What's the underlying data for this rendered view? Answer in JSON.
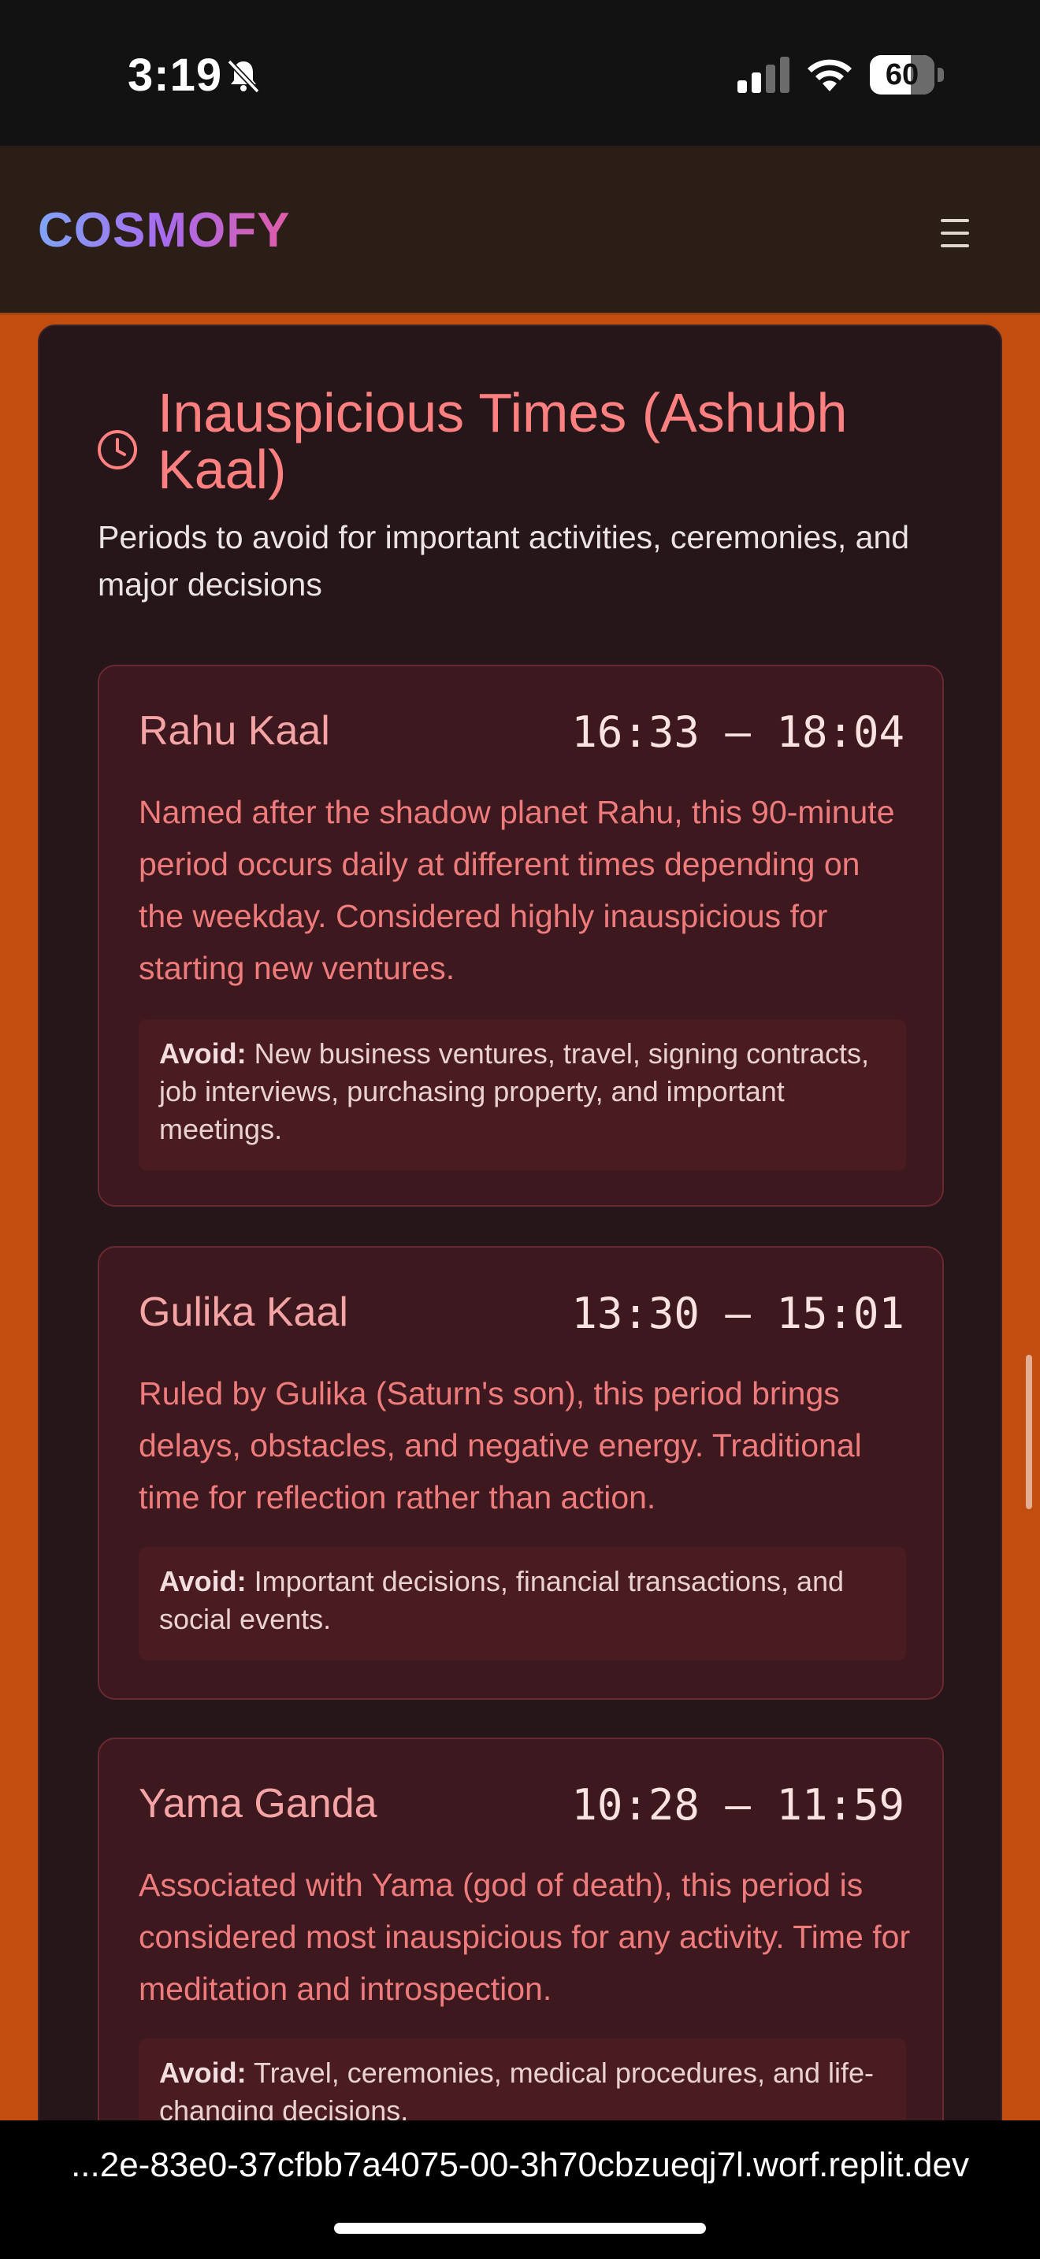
{
  "status_bar": {
    "time": "3:19",
    "battery": "60"
  },
  "nav": {
    "logo": "COSMOFY",
    "menu_icon": "hamburger-menu-icon"
  },
  "section": {
    "title": "Inauspicious Times (Ashubh Kaal)",
    "subtitle": "Periods to avoid for important activities, ceremonies, and major decisions",
    "icon": "clock-icon"
  },
  "periods": [
    {
      "name": "Rahu Kaal",
      "time": "16:33 – 18:04",
      "description": "Named after the shadow planet Rahu, this 90-minute period occurs daily at different times depending on the weekday. Considered highly inauspicious for starting new ventures.",
      "avoid_label": "Avoid:",
      "avoid_text": "New business ventures, travel, signing contracts, job interviews, purchasing property, and important meetings."
    },
    {
      "name": "Gulika Kaal",
      "time": "13:30 – 15:01",
      "description": "Ruled by Gulika (Saturn's son), this period brings delays, obstacles, and negative energy. Traditional time for reflection rather than action.",
      "avoid_label": "Avoid:",
      "avoid_text": "Important decisions, financial transactions, and social events."
    },
    {
      "name": "Yama Ganda",
      "time": "10:28 – 11:59",
      "description": "Associated with Yama (god of death), this period is considered most inauspicious for any activity. Time for meditation and introspection.",
      "avoid_label": "Avoid:",
      "avoid_text": "Travel, ceremonies, medical procedures, and life-changing decisions."
    }
  ],
  "browser": {
    "url": "...2e-83e0-37cfbb7a4075-00-3h70cbzueqj7l.worf.replit.dev"
  },
  "colors": {
    "page_background": "#c24d0e",
    "card_background": "#26161a",
    "accent": "#ff8080"
  }
}
